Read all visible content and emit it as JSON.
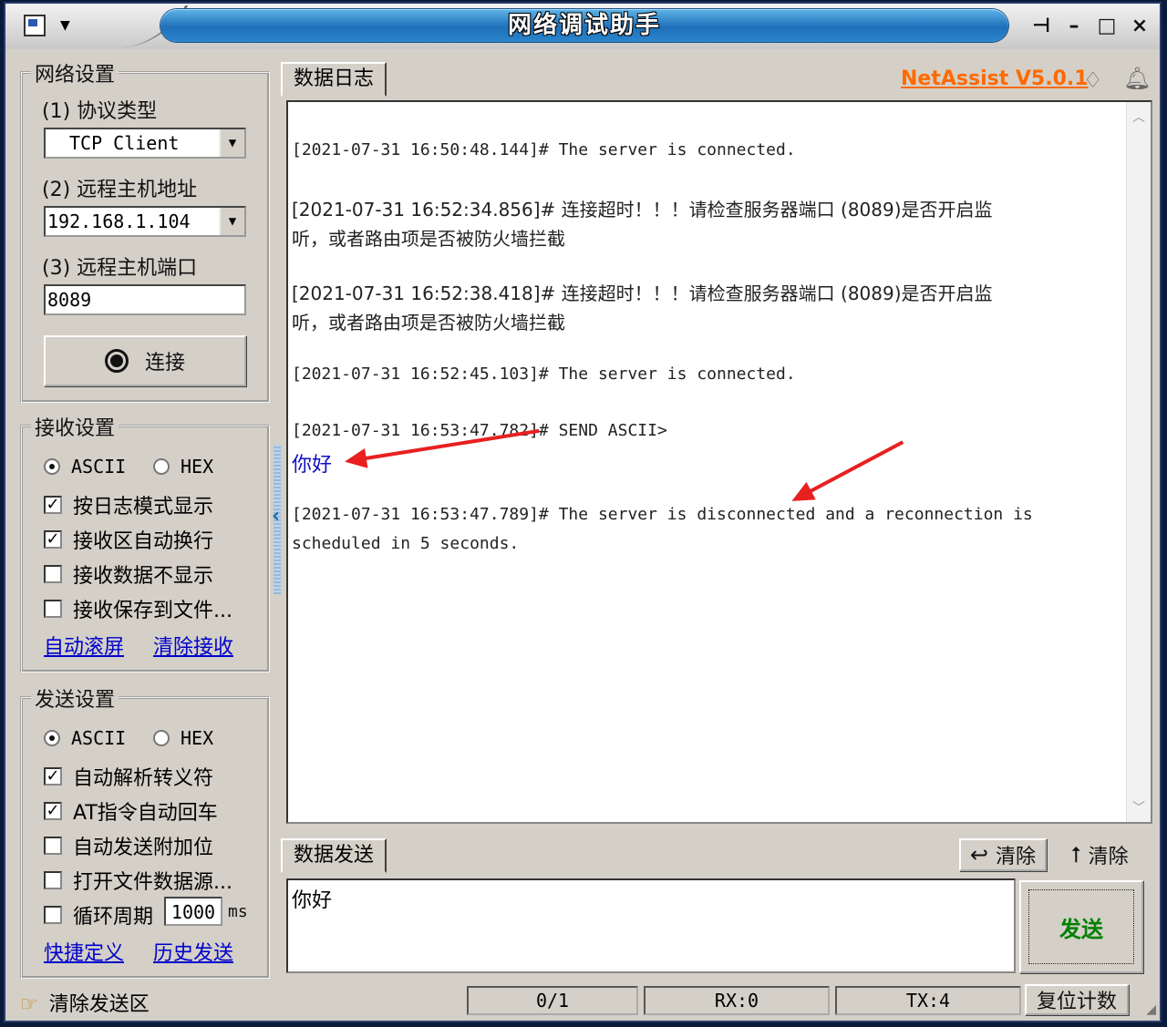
{
  "window": {
    "title": "网络调试助手",
    "controls": {
      "pin": "⊣",
      "minimize": "–",
      "maximize": "□",
      "close": "×"
    }
  },
  "brand": "NetAssist V5.0.1",
  "network": {
    "title": "网络设置",
    "protocol_label": "(1) 协议类型",
    "protocol_value": "TCP Client",
    "host_label": "(2) 远程主机地址",
    "host_value": "192.168.1.104",
    "port_label": "(3) 远程主机端口",
    "port_value": "8089",
    "connect_label": "连接"
  },
  "receive": {
    "title": "接收设置",
    "ascii": "ASCII",
    "hex": "HEX",
    "options": [
      {
        "label": "按日志模式显示",
        "checked": true
      },
      {
        "label": "接收区自动换行",
        "checked": true
      },
      {
        "label": "接收数据不显示",
        "checked": false
      },
      {
        "label": "接收保存到文件...",
        "checked": false
      }
    ],
    "link_autoscroll": "自动滚屏",
    "link_clear": "清除接收"
  },
  "send": {
    "title": "发送设置",
    "ascii": "ASCII",
    "hex": "HEX",
    "options": [
      {
        "label": "自动解析转义符",
        "checked": true
      },
      {
        "label": "AT指令自动回车",
        "checked": true
      },
      {
        "label": "自动发送附加位",
        "checked": false
      },
      {
        "label": "打开文件数据源...",
        "checked": false
      },
      {
        "label": "循环周期",
        "checked": false
      }
    ],
    "cycle_value": "1000",
    "cycle_unit": "ms",
    "link_shortcut": "快捷定义",
    "link_history": "历史发送"
  },
  "log": {
    "tab": "数据日志",
    "lines": [
      "[2021-07-31 16:50:48.144]# The server is connected.",
      "[2021-07-31 16:52:34.856]# 连接超时！！！请检查服务器端口 (8089)是否开启监",
      "听，或者路由项是否被防火墙拦截",
      "[2021-07-31 16:52:38.418]# 连接超时！！！请检查服务器端口 (8089)是否开启监",
      "听，或者路由项是否被防火墙拦截",
      "[2021-07-31 16:52:45.103]# The server is connected.",
      "[2021-07-31 16:53:47.782]# SEND ASCII>",
      "你好",
      "[2021-07-31 16:53:47.789]# The server is disconnected and a reconnection is",
      "scheduled in 5 seconds."
    ]
  },
  "sendpanel": {
    "tab": "数据发送",
    "clear1": "清除",
    "clear2": "清除",
    "text": "你好",
    "send_label": "发送"
  },
  "statusbar": {
    "clear_send": "清除发送区",
    "count": "0/1",
    "rx": "RX:0",
    "tx": "TX:4",
    "reset": "复位计数"
  },
  "colors": {
    "accent": "#ff6a00",
    "title_bar": "#1e6fb8",
    "link": "#0000cc",
    "send": "#008000"
  }
}
